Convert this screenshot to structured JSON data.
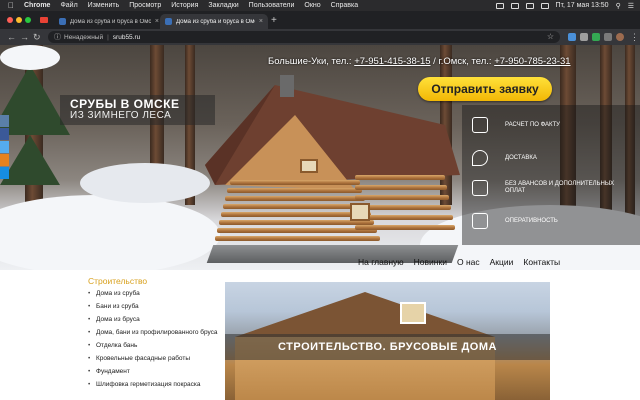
{
  "menubar": {
    "items": [
      "Chrome",
      "Файл",
      "Изменить",
      "Просмотр",
      "История",
      "Закладки",
      "Пользователи",
      "Окно",
      "Справка"
    ],
    "clock": "Пт, 17 мая  13:50"
  },
  "tabs": [
    {
      "title": "Дома из сруба и бруса в Омск",
      "active": false
    },
    {
      "title": "Дома из сруба и бруса в Омск",
      "active": true
    }
  ],
  "toolbar": {
    "security": "Ненадежный",
    "url": "srub55.ru"
  },
  "hero": {
    "brand_line1": "СРУБЫ В ОМСКЕ",
    "brand_line2": "ИЗ ЗИМНЕГО ЛЕСА",
    "phone_prefix1": "Большие-Уки, тел.: ",
    "phone1": "+7-951-415-38-15",
    "phone_sep": " / г.Омск, тел.: ",
    "phone2": "+7-950-785-23-31",
    "order_button": "Отправить заявку",
    "features": [
      {
        "icon": "calculator-icon",
        "label": "Расчет по факту"
      },
      {
        "icon": "location-pin-icon",
        "label": "Доставка"
      },
      {
        "icon": "no-prepayment-icon",
        "label": "Без авансов и дополнительных оплат"
      },
      {
        "icon": "delivery-truck-icon",
        "label": "Оперативность"
      }
    ]
  },
  "topnav": [
    "На главную",
    "Новинки",
    "О нас",
    "Акции",
    "Контакты"
  ],
  "leftmenu": {
    "heading": "Строительство",
    "items": [
      "Дома из сруба",
      "Бани из сруба",
      "Дома из бруса",
      "Дома, бани из профилированного бруса",
      "Отделка бань",
      "Кровельные фасадные работы",
      "Фундамент",
      "Шлифовка герметизация покраска"
    ]
  },
  "main": {
    "caption": "СТРОИТЕЛЬСТВО. БРУСОВЫЕ ДОМА"
  }
}
